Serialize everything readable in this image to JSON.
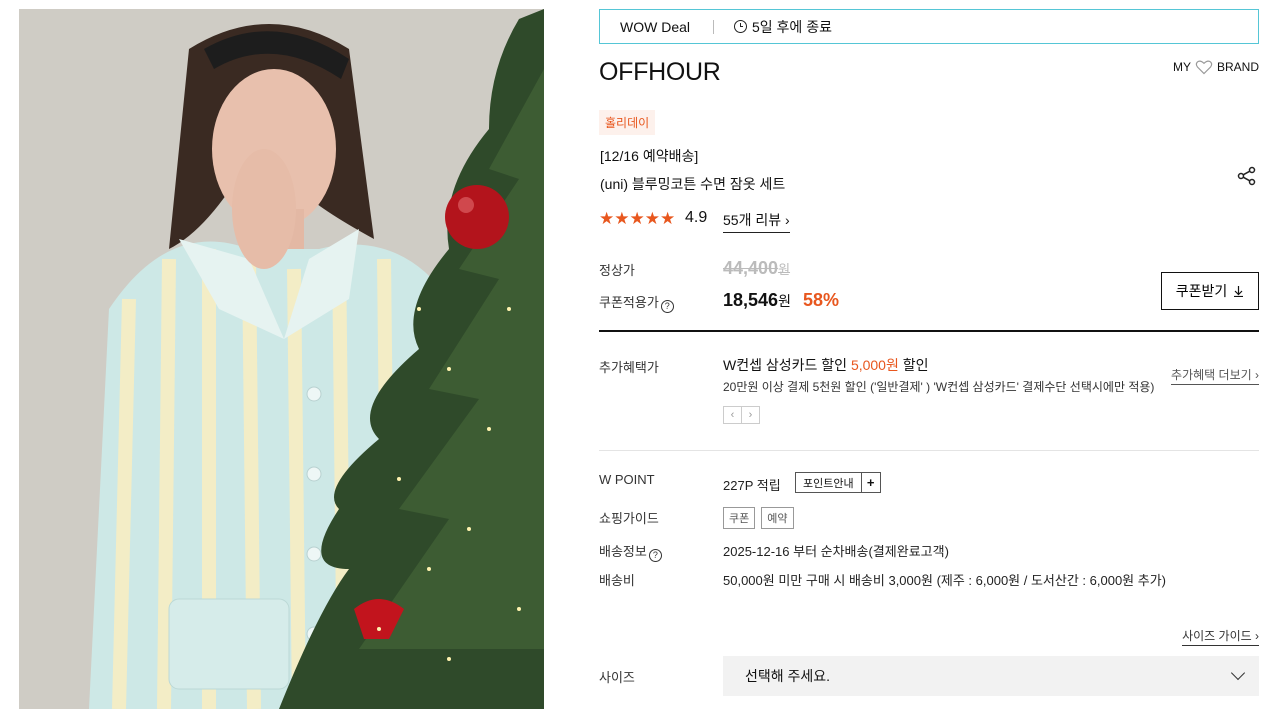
{
  "deal_bar": {
    "label": "WOW Deal",
    "remaining": "5일 후에 종료"
  },
  "brand": {
    "name": "OFFHOUR",
    "my_label": "MY",
    "brand_label": "BRAND"
  },
  "product": {
    "tag": "홀리데이",
    "preorder": "[12/16 예약배송]",
    "title": "(uni) 블루밍코튼 수면 잠옷 세트",
    "rating": "4.9",
    "stars": "★★★★★",
    "reviews": "55개 리뷰 ›"
  },
  "price": {
    "regular_label": "정상가",
    "regular_value": "44,400",
    "regular_unit": "원",
    "coupon_label": "쿠폰적용가",
    "coupon_value": "18,546",
    "coupon_unit": "원",
    "discount": "58%",
    "coupon_button": "쿠폰받기",
    "help_icon": "?"
  },
  "benefit": {
    "label": "추가혜택가",
    "title_prefix": "W컨셉 삼성카드 할인 ",
    "title_amount": "5,000원",
    "title_suffix": " 할인",
    "desc": "20만원 이상 결제 5천원 할인 ('일반결제' ) 'W컨셉 삼성카드' 결제수단 선택시에만 적용)",
    "more": "추가혜택 더보기 ›",
    "prev": "‹",
    "next": "›"
  },
  "info": {
    "point_label": "W POINT",
    "point_value": "227P 적립",
    "point_button": "포인트안내",
    "point_plus": "+",
    "guide_label": "쇼핑가이드",
    "guide_tags": [
      "쿠폰",
      "예약"
    ],
    "delivery_label": "배송정보",
    "delivery_value": "2025-12-16 부터 순차배송(결제완료고객)",
    "fee_label": "배송비",
    "fee_value": "50,000원 미만 구매 시 배송비 3,000원 (제주 : 6,000원 / 도서산간 : 6,000원 추가)"
  },
  "size": {
    "guide_link": "사이즈 가이드 ›",
    "label": "사이즈",
    "placeholder": "선택해 주세요."
  },
  "colors": {
    "accent": "#e8571e",
    "deal_border": "#55c6d6"
  }
}
